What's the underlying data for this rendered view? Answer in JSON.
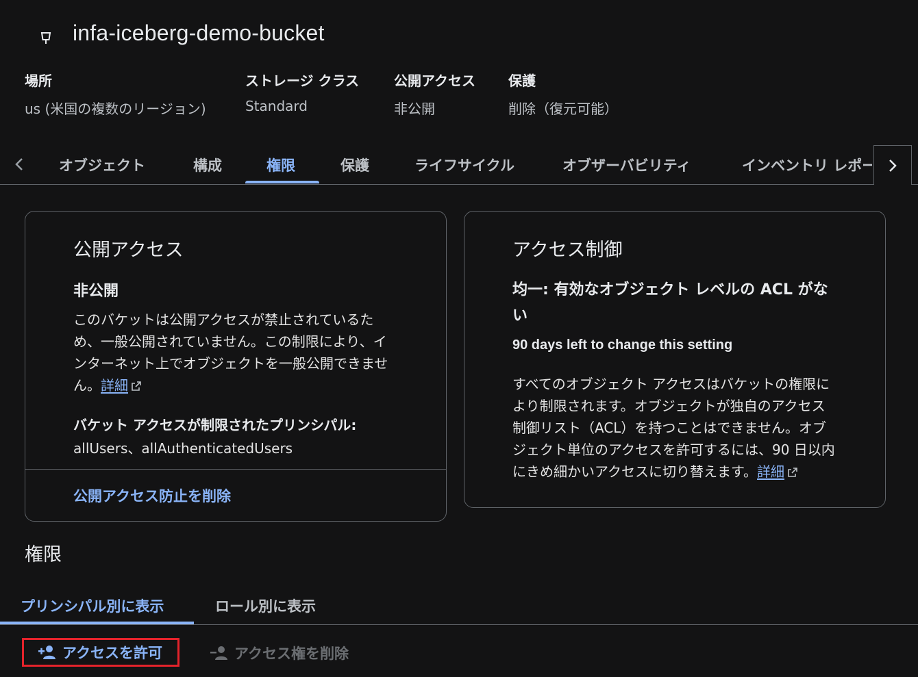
{
  "header": {
    "bucket_name": "infa-iceberg-demo-bucket",
    "icon": "bucket-icon"
  },
  "meta": {
    "location_label": "場所",
    "location_value": "us (米国の複数のリージョン)",
    "storage_class_label": "ストレージ クラス",
    "storage_class_value": "Standard",
    "public_access_label": "公開アクセス",
    "public_access_value": "非公開",
    "protection_label": "保護",
    "protection_value": "削除（復元可能）"
  },
  "tabs": {
    "items": [
      {
        "label": "オブジェクト"
      },
      {
        "label": "構成"
      },
      {
        "label": "権限"
      },
      {
        "label": "保護"
      },
      {
        "label": "ライフサイクル"
      },
      {
        "label": "オブザーバビリティ"
      },
      {
        "label": "インベントリ レポー"
      }
    ],
    "active": "権限"
  },
  "public_access_card": {
    "title": "公開アクセス",
    "status": "非公開",
    "line1": "このバケットは公開アクセスが禁止されているた",
    "line2": "め、一般公開されていません。この制限により、イ",
    "line3": "ンターネット上でオブジェクトを一般公開できませ",
    "line4": "ん。",
    "details_link": "詳細",
    "principals_label": "バケット アクセスが制限されたプリンシパル:",
    "principals_value": "allUsers、allAuthenticatedUsers",
    "action": "公開アクセス防止を削除"
  },
  "access_control_card": {
    "title": "アクセス制御",
    "mode_line1": "均一: 有効なオブジェクト レベルの ACL がな",
    "mode_line2": "い",
    "days_left": "90 days left to change this setting",
    "line1": "すべてのオブジェクト アクセスはバケットの権限に",
    "line2": "より制限されます。オブジェクトが独自のアクセス",
    "line3": "制御リスト（ACL）を持つことはできません。オブ",
    "line4": "ジェクト単位のアクセスを許可するには、90 日以内",
    "line5": "にきめ細かいアクセスに切り替えます。",
    "details_link": "詳細"
  },
  "permissions": {
    "title": "権限",
    "view_by_principal": "プリンシパル別に表示",
    "view_by_role": "ロール別に表示",
    "grant_access": "アクセスを許可",
    "remove_access": "アクセス権を削除"
  },
  "colors": {
    "background": "#131314",
    "accent": "#8ab4f8",
    "highlight_border": "#e4232b"
  }
}
